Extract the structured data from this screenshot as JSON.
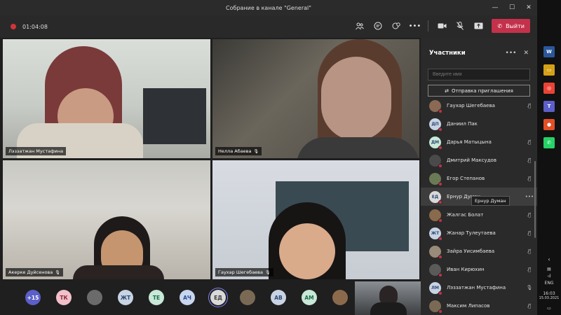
{
  "window": {
    "title": "Собрание в канале \"General\""
  },
  "meeting": {
    "timer": "01:04:08",
    "leave_label": "Выйти"
  },
  "tiles": [
    {
      "name": "Лэззатжан Мустафина"
    },
    {
      "name": "Нелла Абаева"
    },
    {
      "name": "Акерке Дуйсенова"
    },
    {
      "name": "Гаухар Шегебаева"
    }
  ],
  "people_bar": [
    {
      "label": "+15",
      "color": "#5b5fc7",
      "text_color": "#ffffff"
    },
    {
      "label": "ТК",
      "color": "#f3c0c9",
      "text_color": "#8a2b3e"
    },
    {
      "label": "",
      "color": "#6b6b6b",
      "text_color": "#ffffff"
    },
    {
      "label": "ЖТ",
      "color": "#c8d3e3",
      "text_color": "#2e4a74"
    },
    {
      "label": "ТЕ",
      "color": "#c8e8d8",
      "text_color": "#1f6b4a"
    },
    {
      "label": "АЧ",
      "color": "#c8d6f0",
      "text_color": "#2b4b8a"
    },
    {
      "label": "ЕД",
      "color": "#d9d9d9",
      "text_color": "#3c3c3c"
    },
    {
      "label": "",
      "color": "#7a6a55",
      "text_color": "#ffffff"
    },
    {
      "label": "АВ",
      "color": "#c8d3e3",
      "text_color": "#2e4a74"
    },
    {
      "label": "АМ",
      "color": "#c8e8d8",
      "text_color": "#1f6b4a"
    },
    {
      "label": "",
      "color": "#8b6a4c",
      "text_color": "#ffffff"
    }
  ],
  "panel": {
    "title": "Участники",
    "search_placeholder": "Введите имя",
    "invite_label": "Отправка приглашения",
    "participants": [
      {
        "initials": "",
        "name": "Гаухар Шегебаева",
        "color": "#8a6a55",
        "mic": "muted"
      },
      {
        "initials": "ДП",
        "name": "Даниил Пак",
        "color": "#c8d3e3",
        "mic": "none"
      },
      {
        "initials": "ДМ",
        "name": "Дарья Матыцына",
        "color": "#c8e8d8",
        "mic": "muted"
      },
      {
        "initials": "",
        "name": "Дмитрий Максудов",
        "color": "#4a4a4a",
        "mic": "muted"
      },
      {
        "initials": "",
        "name": "Егор Степанов",
        "color": "#6a7a55",
        "mic": "muted"
      },
      {
        "initials": "ЕД",
        "name": "Ернур Думан",
        "color": "#d9d9d9",
        "mic": "more",
        "active": true
      },
      {
        "initials": "",
        "name": "Жалгас Болат",
        "color": "#8a6a4c",
        "mic": "muted"
      },
      {
        "initials": "ЖТ",
        "name": "Жанар Тулеутаева",
        "color": "#c8d3e3",
        "mic": "muted"
      },
      {
        "initials": "",
        "name": "Зайра Уисимбаева",
        "color": "#9a8a7a",
        "mic": "muted"
      },
      {
        "initials": "",
        "name": "Иван Кирюхин",
        "color": "#5a5a5a",
        "mic": "muted"
      },
      {
        "initials": "ЛМ",
        "name": "Лэззатжан Мустафина",
        "color": "#c8d3e3",
        "mic": "on"
      },
      {
        "initials": "",
        "name": "Максим Липасов",
        "color": "#7a6a55",
        "mic": "muted"
      }
    ],
    "tooltip": "Ернур Думан"
  },
  "taskbar": {
    "apps": [
      {
        "label": "W",
        "color": "#2b579a"
      },
      {
        "label": "▭",
        "color": "#d4a017"
      },
      {
        "label": "◎",
        "color": "#ea4335"
      },
      {
        "label": "T",
        "color": "#5b5fc7"
      },
      {
        "label": "●",
        "color": "#e34f26"
      },
      {
        "label": "✆",
        "color": "#25d366"
      }
    ],
    "lang": "ENG",
    "time": "16:03",
    "date": "15.03.2021"
  }
}
